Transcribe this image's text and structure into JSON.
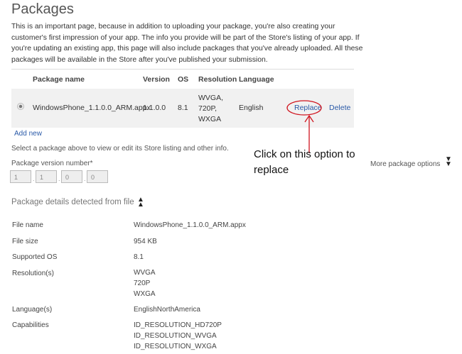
{
  "title": "Packages",
  "intro": "This is an important page, because in addition to uploading your package, you're also creating your customer's first impression of your app. The info you provide will be part of the Store's listing of your app. If you're updating an existing app, this page will also include packages that you've already uploaded. All these packages will be available in the Store after you've published your submission.",
  "table": {
    "headers": {
      "name": "Package name",
      "version": "Version",
      "os": "OS",
      "resolution": "Resolution",
      "language": "Language"
    },
    "row": {
      "name": "WindowsPhone_1.1.0.0_ARM.appx",
      "version": "1.1.0.0",
      "os": "8.1",
      "resolution": [
        "WVGA,",
        "720P,",
        "WXGA"
      ],
      "language": "English",
      "replace": "Replace",
      "delete": "Delete"
    }
  },
  "add_new": "Add new",
  "select_hint": "Select a package above to view or edit its Store listing and other info.",
  "version_label": "Package version number*",
  "version_parts": [
    "1",
    "1",
    "0",
    "0"
  ],
  "annotation": [
    "Click on this option to",
    "replace"
  ],
  "more_options": "More package options",
  "details_title": "Package details detected from file",
  "details": {
    "file_name_label": "File name",
    "file_name": "WindowsPhone_1.1.0.0_ARM.appx",
    "file_size_label": "File size",
    "file_size": "954 KB",
    "os_label": "Supported OS",
    "os": "8.1",
    "res_label": "Resolution(s)",
    "res": [
      "WVGA",
      "720P",
      "WXGA"
    ],
    "lang_label": "Language(s)",
    "lang": "EnglishNorthAmerica",
    "cap_label": "Capabilities",
    "caps": [
      "ID_RESOLUTION_HD720P",
      "ID_RESOLUTION_WVGA",
      "ID_RESOLUTION_WXGA"
    ]
  },
  "colors": {
    "link": "#2a5aa8",
    "annotation": "#d0141e"
  }
}
